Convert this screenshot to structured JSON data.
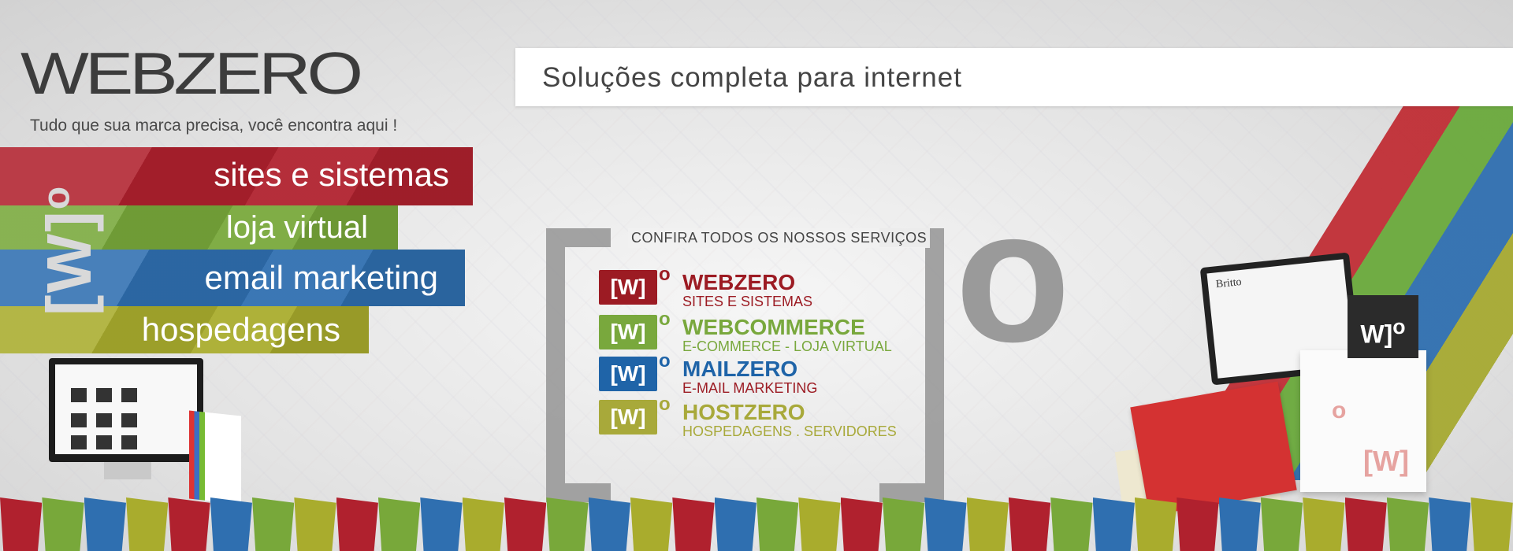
{
  "header": {
    "logo": "WEBZERO",
    "tagline": "Tudo que sua marca precisa, você encontra aqui !",
    "topbar_title": "Soluções completa para internet"
  },
  "ribbons": [
    {
      "label": "sites e sistemas",
      "color": "#b0212e"
    },
    {
      "label": "loja virtual",
      "color": "#78a83a"
    },
    {
      "label": "email marketing",
      "color": "#2f6fb0"
    },
    {
      "label": "hospedagens",
      "color": "#a9ac2d"
    }
  ],
  "brand_mark": {
    "bracket": "[W]",
    "degree": "o"
  },
  "center": {
    "heading": "CONFIRA TODOS OS NOSSOS SERVIÇOS",
    "big_degree": "o"
  },
  "services": [
    {
      "mark": "[W]",
      "degree": "o",
      "name": "WEBZERO",
      "subtitle": "SITES E SISTEMAS",
      "color": "#9c1b23"
    },
    {
      "mark": "[W]",
      "degree": "o",
      "name": "WEBCOMMERCE",
      "subtitle": "E-COMMERCE - LOJA VIRTUAL",
      "color": "#79a83d"
    },
    {
      "mark": "[W]",
      "degree": "o",
      "name": "MAILZERO",
      "subtitle": "E-MAIL MARKETING",
      "color": "#1f64a8",
      "subtitle_color": "#9c1b23"
    },
    {
      "mark": "[W]",
      "degree": "o",
      "name": "HOSTZERO",
      "subtitle": "HOSPEDAGENS . SERVIDORES",
      "color": "#a8a93a"
    }
  ],
  "right_art": {
    "laptop_site": "Britto",
    "dark_bag_mark": "W]",
    "dark_bag_degree": "o",
    "white_bag_mark": "[W]",
    "white_bag_degree": "o"
  },
  "flag_colors": [
    "#b0212e",
    "#78a83a",
    "#2f6fb0",
    "#a9ac2d"
  ]
}
